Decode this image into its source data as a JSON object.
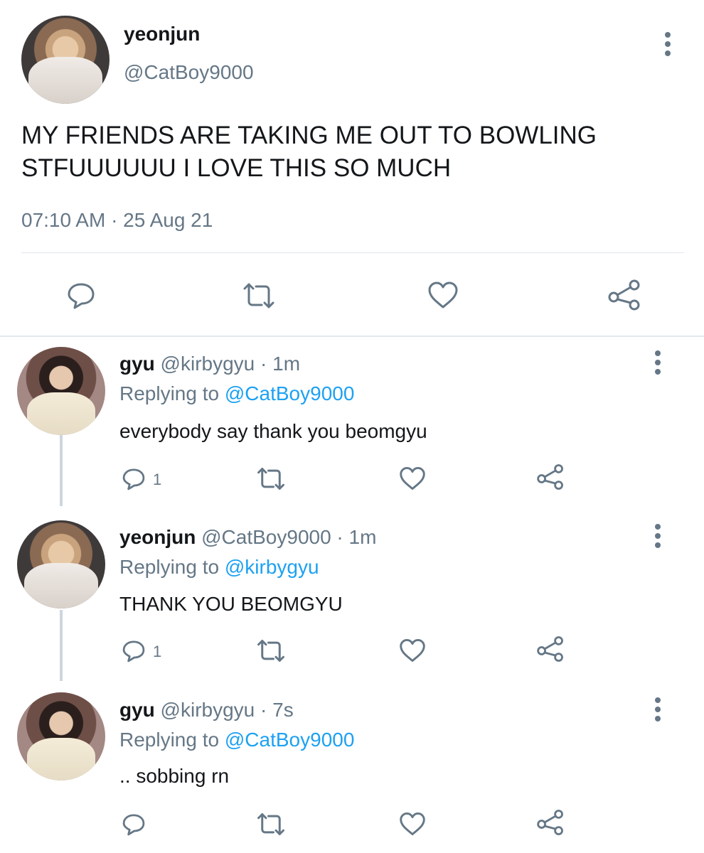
{
  "main_tweet": {
    "display_name": "yeonjun",
    "handle": "@CatBoy9000",
    "text": "MY FRIENDS ARE TAKING ME OUT TO BOWLING STFUUUUUU I LOVE THIS SO MUCH",
    "timestamp": "07:10 AM · 25 Aug 21",
    "actions": [
      "reply-icon",
      "retweet-icon",
      "like-icon",
      "share-icon"
    ]
  },
  "replies": [
    {
      "display_name": "gyu",
      "meta": " @kirbygyu · 1m",
      "replying_prefix": "Replying to ",
      "replying_to": "@CatBoy9000",
      "text": "everybody say thank you beomgyu",
      "reply_count": "1"
    },
    {
      "display_name": "yeonjun",
      "meta": " @CatBoy9000 · 1m",
      "replying_prefix": "Replying to ",
      "replying_to": "@kirbygyu",
      "text": "THANK YOU BEOMGYU",
      "reply_count": "1"
    },
    {
      "display_name": "gyu",
      "meta": " @kirbygyu · 7s",
      "replying_prefix": "Replying to ",
      "replying_to": "@CatBoy9000",
      "text": ".. sobbing rn",
      "reply_count": ""
    }
  ],
  "colors": {
    "text": "#14171a",
    "secondary": "#657786",
    "link": "#1da1f2",
    "divider": "#e1e8ed"
  }
}
